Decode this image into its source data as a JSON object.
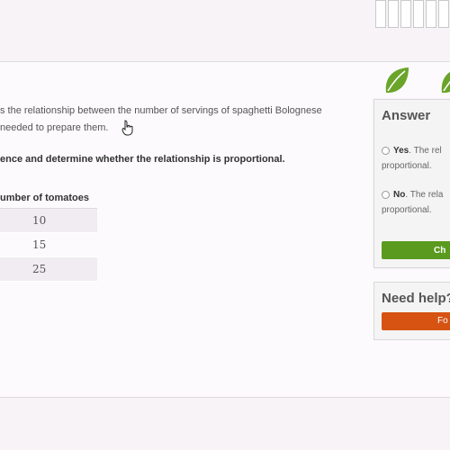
{
  "question": {
    "line1": "s the relationship between the number of servings of spaghetti Bolognese",
    "line2": "needed to prepare them.",
    "instruction": "ence and determine whether the relationship is proportional."
  },
  "table": {
    "header": "umber of tomatoes",
    "values": [
      "10",
      "15",
      "25"
    ]
  },
  "answer": {
    "title": "Answer",
    "options": [
      {
        "label": "Yes",
        "text_line1": ". The rel",
        "text_line2": "proportional."
      },
      {
        "label": "No",
        "text_line1": ". The rela",
        "text_line2": "proportional."
      }
    ],
    "check_label": "Ch"
  },
  "help": {
    "title": "Need help?",
    "button_label": "Fo"
  },
  "colors": {
    "leaf": "#6aa52a",
    "check_button": "#5a9a1e",
    "help_button": "#d65312"
  },
  "icons": [
    "leaf-icon",
    "hand-cursor-icon",
    "radio-icon"
  ]
}
